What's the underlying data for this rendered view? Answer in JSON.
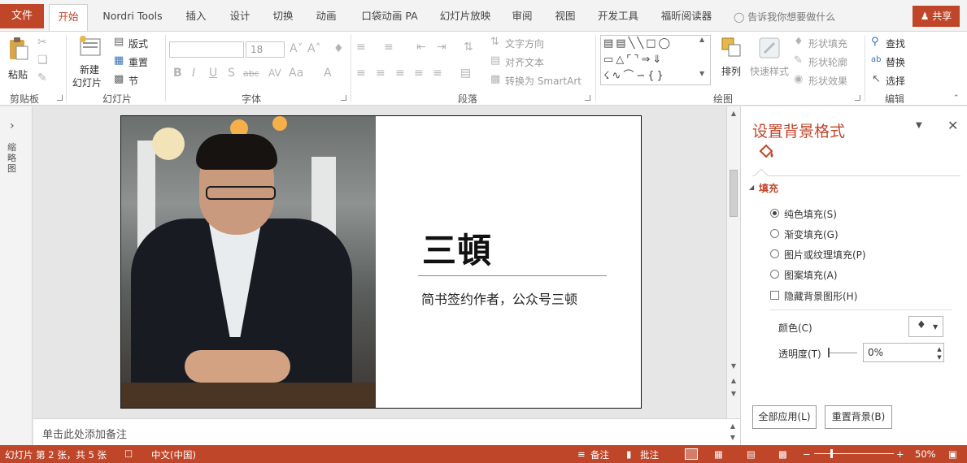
{
  "tabs": {
    "file": "文件",
    "items": [
      "开始",
      "Nordri Tools",
      "插入",
      "设计",
      "切换",
      "动画",
      "口袋动画 PA",
      "幻灯片放映",
      "审阅",
      "视图",
      "开发工具",
      "福昕阅读器"
    ],
    "active_index": 0,
    "tell_me": "告诉我你想要做什么",
    "share": "共享"
  },
  "ribbon": {
    "clipboard": {
      "label": "剪贴板",
      "paste": "粘贴"
    },
    "slides": {
      "label": "幻灯片",
      "new_slide_1": "新建",
      "new_slide_2": "幻灯片",
      "layout": "版式",
      "reset": "重置",
      "section": "节"
    },
    "font": {
      "label": "字体",
      "name_value": "",
      "size_value": "18"
    },
    "paragraph": {
      "label": "段落",
      "text_direction": "文字方向",
      "align_text": "对齐文本",
      "smartart": "转换为 SmartArt"
    },
    "drawing": {
      "label": "绘图",
      "arrange": "排列",
      "quick_styles": "快速样式",
      "shape_fill": "形状填充",
      "shape_outline": "形状轮廓",
      "shape_effects": "形状效果"
    },
    "editing": {
      "label": "编辑",
      "find": "查找",
      "replace": "替换",
      "select": "选择"
    }
  },
  "left_rail": {
    "label": "缩略图"
  },
  "slide": {
    "name": "三頓",
    "subtitle": "简书签约作者，公众号三顿"
  },
  "notes": {
    "placeholder": "单击此处添加备注"
  },
  "format_pane": {
    "title": "设置背景格式",
    "section": "填充",
    "options": [
      {
        "label": "纯色填充(S)",
        "selected": true
      },
      {
        "label": "渐变填充(G)",
        "selected": false
      },
      {
        "label": "图片或纹理填充(P)",
        "selected": false
      },
      {
        "label": "图案填充(A)",
        "selected": false
      }
    ],
    "hide_bg": {
      "label": "隐藏背景图形(H)",
      "checked": false
    },
    "color_label": "颜色(C)",
    "transparency_label": "透明度(T)",
    "transparency_value": "0%",
    "apply_all": "全部应用(L)",
    "reset_bg": "重置背景(B)"
  },
  "status": {
    "slide_info": "幻灯片 第 2 张，共 5 张",
    "language": "中文(中国)",
    "notes": "备注",
    "comments": "批注",
    "zoom": "50%",
    "accent": "#c0462a"
  }
}
